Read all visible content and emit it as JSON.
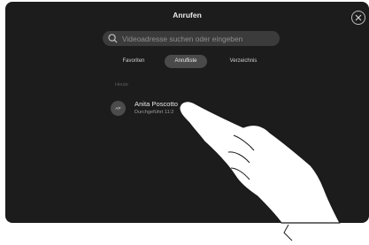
{
  "header": {
    "title": "Anrufen"
  },
  "icons": {
    "close": "close-icon",
    "search": "search-icon"
  },
  "search": {
    "placeholder": "Videoadresse suchen oder eingeben",
    "value": ""
  },
  "tabs": [
    {
      "label": "Favoriten",
      "selected": false
    },
    {
      "label": "Anrufliste",
      "selected": true
    },
    {
      "label": "Verzeichnis",
      "selected": false
    }
  ],
  "recents": {
    "section_label": "Heute",
    "items": [
      {
        "initials": "AP",
        "name": "Anita Poscotto",
        "subtitle": "Durchgeführt 11:2"
      }
    ]
  },
  "colors": {
    "background": "#1c1c1c",
    "selected_tab": "#4a4a4a",
    "search_field": "#3b3b3b"
  }
}
